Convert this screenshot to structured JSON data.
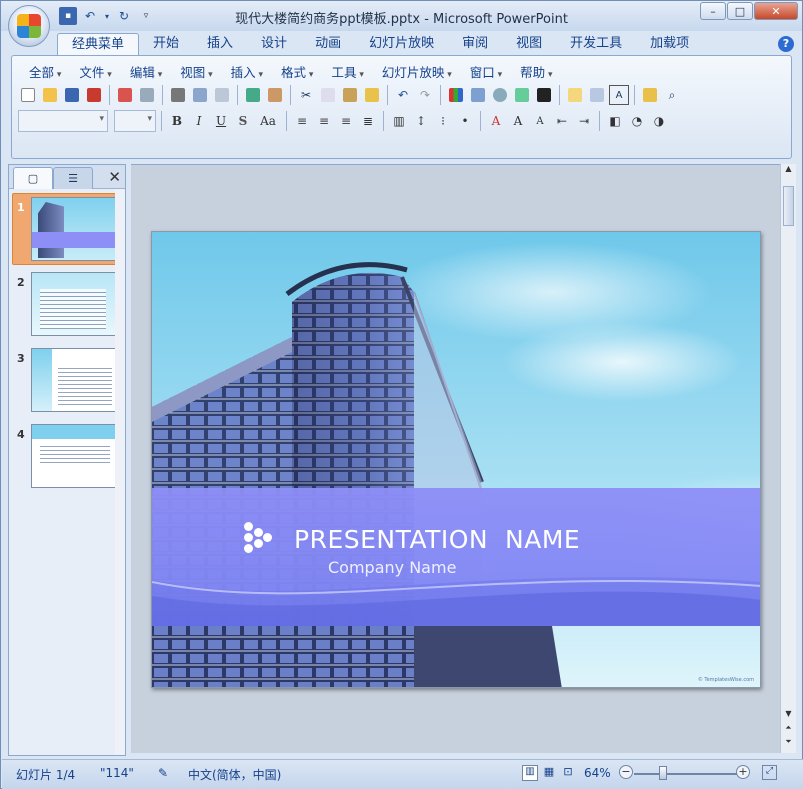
{
  "window": {
    "title": "现代大楼简约商务ppt模板.pptx - Microsoft PowerPoint",
    "controls": {
      "minimize": "–",
      "maximize": "□",
      "close": "✕"
    }
  },
  "ribbon_tabs": [
    "经典菜单",
    "开始",
    "插入",
    "设计",
    "动画",
    "幻灯片放映",
    "审阅",
    "视图",
    "开发工具",
    "加载项"
  ],
  "active_tab": "经典菜单",
  "classic_menu": [
    "全部",
    "文件",
    "编辑",
    "视图",
    "插入",
    "格式",
    "工具",
    "幻灯片放映",
    "窗口",
    "帮助"
  ],
  "format_buttons": {
    "bold": "B",
    "italic": "I",
    "underline": "U",
    "shadow": "S",
    "case": "Aa",
    "font_color": "A"
  },
  "slides_pane": {
    "thumbnails": [
      {
        "num": "1",
        "selected": true
      },
      {
        "num": "2",
        "selected": false
      },
      {
        "num": "3",
        "selected": false
      },
      {
        "num": "4",
        "selected": false
      }
    ]
  },
  "slide": {
    "title": "PRESENTATION  NAME",
    "subtitle": "Company Name",
    "credit": "© TemplatesWise.com"
  },
  "status_bar": {
    "slide_info": "幻灯片 1/4",
    "theme": "\"114\"",
    "language": "中文(简体，中国)",
    "zoom": "64%"
  },
  "colors": {
    "accent_band": "#8e8ef7",
    "selected_thumb": "#f0a770",
    "ribbon": "#dbe6f4"
  }
}
